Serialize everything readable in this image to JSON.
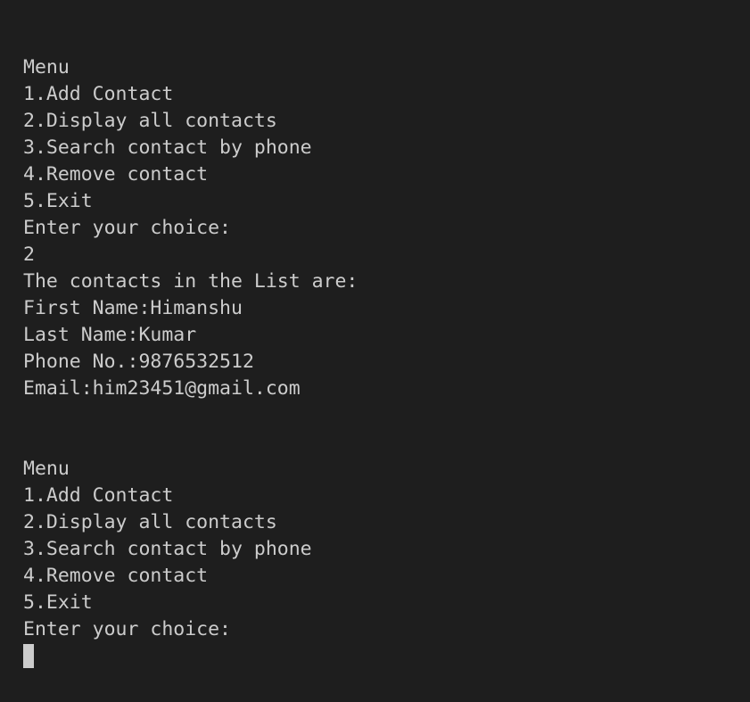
{
  "terminal": {
    "lines": [
      "Menu",
      "1.Add Contact",
      "2.Display all contacts",
      "3.Search contact by phone",
      "4.Remove contact",
      "5.Exit",
      "Enter your choice:",
      "2",
      "The contacts in the List are:",
      "First Name:Himanshu",
      "Last Name:Kumar",
      "Phone No.:9876532512",
      "Email:him23451@gmail.com",
      "",
      "",
      "Menu",
      "1.Add Contact",
      "2.Display all contacts",
      "3.Search contact by phone",
      "4.Remove contact",
      "5.Exit",
      "Enter your choice:"
    ]
  },
  "colors": {
    "background": "#1e1e1e",
    "foreground": "#cccccc"
  }
}
